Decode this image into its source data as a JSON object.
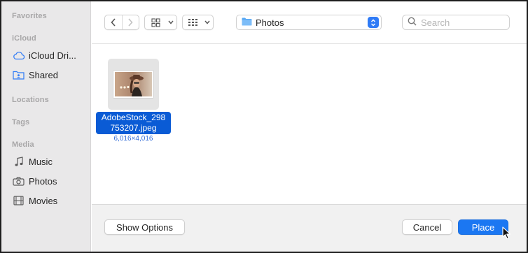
{
  "sidebar": {
    "sections": {
      "favorites": "Favorites",
      "icloud": "iCloud",
      "locations": "Locations",
      "tags": "Tags",
      "media": "Media"
    },
    "items": [
      {
        "label": "iCloud Dri...",
        "icon": "cloud-icon"
      },
      {
        "label": "Shared",
        "icon": "shared-folder-icon"
      },
      {
        "label": "Music",
        "icon": "music-note-icon"
      },
      {
        "label": "Photos",
        "icon": "camera-icon"
      },
      {
        "label": "Movies",
        "icon": "film-icon"
      }
    ],
    "accent": "#2f7bf6"
  },
  "toolbar": {
    "location": "Photos",
    "search_placeholder": "Search"
  },
  "files": [
    {
      "name_line1": "AdobeStock_298",
      "name_line2": "753207.jpeg",
      "dimensions": "6,016×4,016",
      "selected": true
    }
  ],
  "footer": {
    "show_options": "Show Options",
    "cancel": "Cancel",
    "place": "Place"
  },
  "colors": {
    "selection": "#0a5bd5",
    "primary_button": "#1b77f2",
    "sidebar_bg": "#e9e8e9"
  }
}
